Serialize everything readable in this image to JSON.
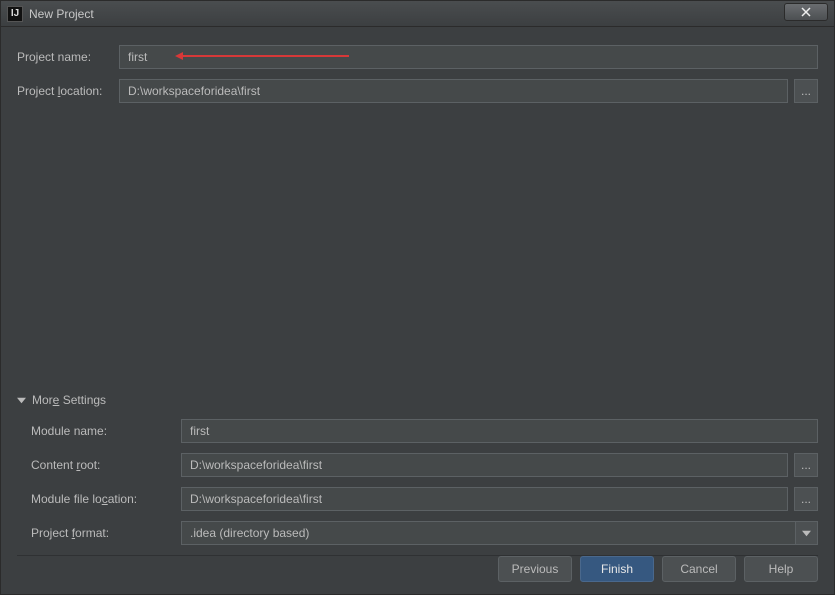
{
  "titlebar": {
    "title": "New Project"
  },
  "top": {
    "project_name_label": "Project name:",
    "project_name_value": "first",
    "project_location_label": "Project location:",
    "project_location_value": "D:\\workspaceforidea\\first"
  },
  "more": {
    "header": "More Settings",
    "module_name_label": "Module name:",
    "module_name_value": "first",
    "content_root_label": "Content root:",
    "content_root_value": "D:\\workspaceforidea\\first",
    "module_file_loc_label": "Module file location:",
    "module_file_loc_value": "D:\\workspaceforidea\\first",
    "project_format_label": "Project format:",
    "project_format_value": ".idea (directory based)"
  },
  "buttons": {
    "previous": "Previous",
    "finish": "Finish",
    "cancel": "Cancel",
    "help": "Help"
  },
  "browse_label": "..."
}
